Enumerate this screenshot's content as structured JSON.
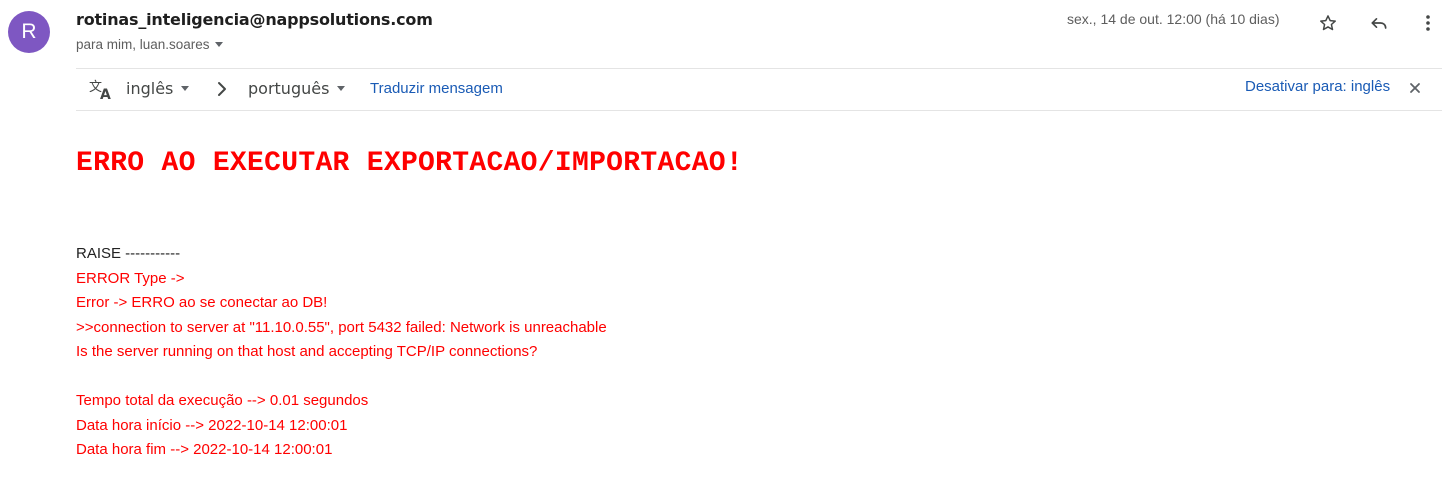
{
  "avatar": {
    "letter": "R",
    "color": "#7e57c2"
  },
  "header": {
    "sender": "rotinas_inteligencia@nappsolutions.com",
    "recipients": "para mim, luan.soares",
    "date": "sex., 14 de out. 12:00 (há 10 dias)"
  },
  "actions": {
    "star_icon": "star-icon",
    "reply_icon": "reply-icon",
    "more_icon": "more-vertical-icon"
  },
  "translation": {
    "from_lang": "inglês",
    "to_lang": "português",
    "translate_label": "Traduzir mensagem",
    "disable_label": "Desativar para: inglês"
  },
  "message": {
    "headline": "ERRO AO EXECUTAR EXPORTACAO/IMPORTACAO!",
    "raise_line": "RAISE -----------",
    "error_lines": [
      "ERROR Type ->",
      "Error -> ERRO ao se conectar ao DB!",
      ">>connection to server at \"11.10.0.55\", port 5432 failed: Network is unreachable",
      "Is the server running on that host and accepting TCP/IP connections?"
    ],
    "summary_lines": [
      "Tempo total da execução --> 0.01 segundos",
      "Data hora início --> 2022-10-14 12:00:01",
      "Data hora fim --> 2022-10-14 12:00:01"
    ]
  },
  "colors": {
    "error_red": "#ff0000",
    "link_blue": "#1a5bb5"
  }
}
